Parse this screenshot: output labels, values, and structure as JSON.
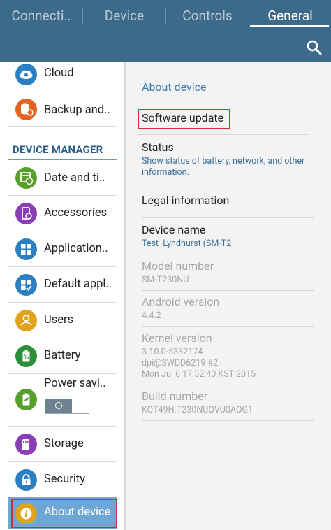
{
  "tabs": [
    {
      "label": "Connecti..",
      "selected": false
    },
    {
      "label": "Device",
      "selected": false
    },
    {
      "label": "Controls",
      "selected": false
    },
    {
      "label": "General",
      "selected": true
    }
  ],
  "colors": {
    "top_bar": "#3d6a8a",
    "accent_blue": "#3b7cb0",
    "selected_item_bg": "#6ea7d6",
    "highlight_red": "#d2303a"
  },
  "sidebar": {
    "section_header": "DEVICE MANAGER",
    "items": [
      {
        "label": "Cloud",
        "icon": "cloud-icon",
        "color": "#2d7fc4"
      },
      {
        "label": "Backup and..",
        "icon": "backup-icon",
        "color": "#e2641e"
      },
      {
        "label": "Date and ti..",
        "icon": "calendar-clock-icon",
        "color": "#57a02c"
      },
      {
        "label": "Accessories",
        "icon": "accessories-icon",
        "color": "#8a3fb7"
      },
      {
        "label": "Application..",
        "icon": "apps-grid-icon",
        "color": "#2d7fc4"
      },
      {
        "label": "Default appl..",
        "icon": "default-apps-icon",
        "color": "#2d7fc4"
      },
      {
        "label": "Users",
        "icon": "users-icon",
        "color": "#e0a31c"
      },
      {
        "label": "Battery",
        "icon": "battery-icon",
        "color": "#2e8f3a"
      },
      {
        "label": "Power savi..",
        "icon": "power-saving-icon",
        "color": "#57a02c"
      },
      {
        "label": "Storage",
        "icon": "sd-card-icon",
        "color": "#8a3fb7"
      },
      {
        "label": "Security",
        "icon": "lock-icon",
        "color": "#2d7fc4"
      },
      {
        "label": "About device",
        "icon": "info-icon",
        "color": "#e0a31c"
      }
    ],
    "power_saving_toggle": "off"
  },
  "detail": {
    "header": "About device",
    "rows": [
      {
        "title": "Software update",
        "subtitle": "",
        "enabled": true
      },
      {
        "title": "Status",
        "subtitle": "Show status of battery, network, and other information.",
        "enabled": true
      },
      {
        "title": "Legal information",
        "subtitle": "",
        "enabled": true
      },
      {
        "title": "Device name",
        "subtitle": "Test  Lyndhurst (SM-T2",
        "enabled": true
      },
      {
        "title": "Model number",
        "subtitle": "SM-T230NU",
        "enabled": false
      },
      {
        "title": "Android version",
        "subtitle": "4.4.2",
        "enabled": false
      },
      {
        "title": "Kernel version",
        "subtitle_lines": [
          "3.10.0-5332174",
          "dpi@SWDD6219 #2",
          "Mon Jul 6 17:52:40 KST 2015"
        ],
        "enabled": false
      },
      {
        "title": "Build number",
        "subtitle": "KOT49H.T230NUOVU0AOG1",
        "enabled": false
      }
    ]
  }
}
